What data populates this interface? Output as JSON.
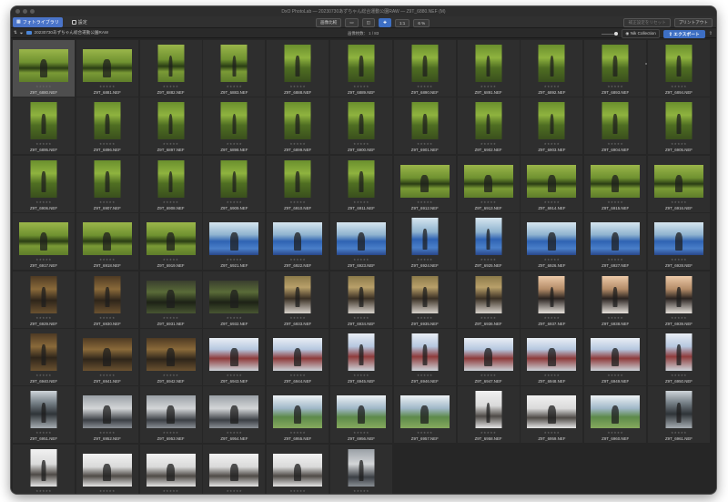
{
  "window": {
    "title": "DxO PhotoLab — 20230730あずちゃん総合運動公園RAW — Z9T_6880.NEF (M)"
  },
  "toolbar": {
    "library_tab": "フォトライブラリ",
    "settings_tab": "設定",
    "compare_button": "画像比較",
    "zoom_label": "1:1",
    "zoom_value": "6 %",
    "reset_button": "補正設定をリセット",
    "print_button": "プリントアウト"
  },
  "filterbar": {
    "folder_name": "20230730あずちゃん総合運動公園RAW",
    "image_count": "画像枚数：    1 / 83",
    "nik_button": "Nik Collection",
    "export_button": "エクスポート"
  },
  "icons": [
    "grid-icon",
    "photo-icon",
    "sort-icon",
    "filter-icon",
    "folder-icon",
    "zoom-icon",
    "nik-icon",
    "export-icon",
    "share-icon"
  ],
  "colors": {
    "accent": "#4a74c9",
    "window_bg": "#262626",
    "selected_cell": "#4e4e4e"
  },
  "rating_placeholder": "★★★★★",
  "thumbnails": [
    {
      "name": "Z9T_6880.NEF",
      "o": "l",
      "s": "s-park"
    },
    {
      "name": "Z9T_6881.NEF",
      "o": "l",
      "s": "s-park"
    },
    {
      "name": "Z9T_6882.NEF",
      "o": "p",
      "s": "s-park"
    },
    {
      "name": "Z9T_6883.NEF",
      "o": "p",
      "s": "s-park"
    },
    {
      "name": "Z9T_6888.NEF",
      "o": "p",
      "s": "s-forest"
    },
    {
      "name": "Z9T_6889.NEF",
      "o": "p",
      "s": "s-forest"
    },
    {
      "name": "Z9T_6890.NEF",
      "o": "p",
      "s": "s-forest"
    },
    {
      "name": "Z9T_6891.NEF",
      "o": "p",
      "s": "s-forest"
    },
    {
      "name": "Z9T_6892.NEF",
      "o": "p",
      "s": "s-forest"
    },
    {
      "name": "Z9T_6893.NEF",
      "o": "p",
      "s": "s-forest"
    },
    {
      "name": "Z9T_6894.NEF",
      "o": "p",
      "s": "s-forest"
    },
    {
      "name": "Z9T_6895.NEF",
      "o": "p",
      "s": "s-forest"
    },
    {
      "name": "Z9T_6896.NEF",
      "o": "p",
      "s": "s-forest"
    },
    {
      "name": "Z9T_6897.NEF",
      "o": "p",
      "s": "s-forest"
    },
    {
      "name": "Z9T_6898.NEF",
      "o": "p",
      "s": "s-forest"
    },
    {
      "name": "Z9T_6899.NEF",
      "o": "p",
      "s": "s-forest"
    },
    {
      "name": "Z9T_6900.NEF",
      "o": "p",
      "s": "s-forest"
    },
    {
      "name": "Z9T_6901.NEF",
      "o": "p",
      "s": "s-forest"
    },
    {
      "name": "Z9T_6902.NEF",
      "o": "p",
      "s": "s-forest"
    },
    {
      "name": "Z9T_6903.NEF",
      "o": "p",
      "s": "s-forest"
    },
    {
      "name": "Z9T_6904.NEF",
      "o": "p",
      "s": "s-forest"
    },
    {
      "name": "Z9T_6905.NEF",
      "o": "p",
      "s": "s-forest"
    },
    {
      "name": "Z9T_6906.NEF",
      "o": "p",
      "s": "s-forest"
    },
    {
      "name": "Z9T_6907.NEF",
      "o": "p",
      "s": "s-forest"
    },
    {
      "name": "Z9T_6908.NEF",
      "o": "p",
      "s": "s-forest"
    },
    {
      "name": "Z9T_6909.NEF",
      "o": "p",
      "s": "s-forest"
    },
    {
      "name": "Z9T_6910.NEF",
      "o": "p",
      "s": "s-forest"
    },
    {
      "name": "Z9T_6911.NEF",
      "o": "p",
      "s": "s-forest"
    },
    {
      "name": "Z9T_6912.NEF",
      "o": "l",
      "s": "s-park"
    },
    {
      "name": "Z9T_6913.NEF",
      "o": "l",
      "s": "s-park"
    },
    {
      "name": "Z9T_6914.NEF",
      "o": "l",
      "s": "s-park"
    },
    {
      "name": "Z9T_6915.NEF",
      "o": "l",
      "s": "s-park"
    },
    {
      "name": "Z9T_6916.NEF",
      "o": "l",
      "s": "s-park"
    },
    {
      "name": "Z9T_6917.NEF",
      "o": "l",
      "s": "s-park"
    },
    {
      "name": "Z9T_6918.NEF",
      "o": "l",
      "s": "s-park"
    },
    {
      "name": "Z9T_6919.NEF",
      "o": "l",
      "s": "s-park"
    },
    {
      "name": "Z9T_6921.NEF",
      "o": "l",
      "s": "s-track"
    },
    {
      "name": "Z9T_6922.NEF",
      "o": "l",
      "s": "s-track"
    },
    {
      "name": "Z9T_6923.NEF",
      "o": "l",
      "s": "s-track"
    },
    {
      "name": "Z9T_6924.NEF",
      "o": "p",
      "s": "s-track"
    },
    {
      "name": "Z9T_6925.NEF",
      "o": "p",
      "s": "s-track"
    },
    {
      "name": "Z9T_6926.NEF",
      "o": "l",
      "s": "s-track"
    },
    {
      "name": "Z9T_6927.NEF",
      "o": "l",
      "s": "s-track"
    },
    {
      "name": "Z9T_6928.NEF",
      "o": "l",
      "s": "s-track"
    },
    {
      "name": "Z9T_6929.NEF",
      "o": "p",
      "s": "s-bench"
    },
    {
      "name": "Z9T_6930.NEF",
      "o": "p",
      "s": "s-bench"
    },
    {
      "name": "Z9T_6931.NEF",
      "o": "l",
      "s": "s-dark"
    },
    {
      "name": "Z9T_6932.NEF",
      "o": "l",
      "s": "s-dark"
    },
    {
      "name": "Z9T_6933.NEF",
      "o": "p",
      "s": "s-close"
    },
    {
      "name": "Z9T_6934.NEF",
      "o": "p",
      "s": "s-close"
    },
    {
      "name": "Z9T_6935.NEF",
      "o": "p",
      "s": "s-close"
    },
    {
      "name": "Z9T_6936.NEF",
      "o": "p",
      "s": "s-close"
    },
    {
      "name": "Z9T_6937.NEF",
      "o": "p",
      "s": "s-face"
    },
    {
      "name": "Z9T_6938.NEF",
      "o": "p",
      "s": "s-face"
    },
    {
      "name": "Z9T_6939.NEF",
      "o": "p",
      "s": "s-face"
    },
    {
      "name": "Z9T_6940.NEF",
      "o": "p",
      "s": "s-bench"
    },
    {
      "name": "Z9T_6941.NEF",
      "o": "l",
      "s": "s-bench"
    },
    {
      "name": "Z9T_6942.NEF",
      "o": "l",
      "s": "s-bench"
    },
    {
      "name": "Z9T_6943.NEF",
      "o": "l",
      "s": "s-stadium"
    },
    {
      "name": "Z9T_6944.NEF",
      "o": "l",
      "s": "s-stadium"
    },
    {
      "name": "Z9T_6945.NEF",
      "o": "p",
      "s": "s-stadium"
    },
    {
      "name": "Z9T_6946.NEF",
      "o": "p",
      "s": "s-stadium"
    },
    {
      "name": "Z9T_6947.NEF",
      "o": "l",
      "s": "s-stadium"
    },
    {
      "name": "Z9T_6948.NEF",
      "o": "l",
      "s": "s-stadium"
    },
    {
      "name": "Z9T_6949.NEF",
      "o": "l",
      "s": "s-stadium"
    },
    {
      "name": "Z9T_6950.NEF",
      "o": "p",
      "s": "s-stadium"
    },
    {
      "name": "Z9T_6951.NEF",
      "o": "p",
      "s": "s-fence"
    },
    {
      "name": "Z9T_6952.NEF",
      "o": "l",
      "s": "s-bw"
    },
    {
      "name": "Z9T_6953.NEF",
      "o": "l",
      "s": "s-bw"
    },
    {
      "name": "Z9T_6954.NEF",
      "o": "l",
      "s": "s-bw"
    },
    {
      "name": "Z9T_6955.NEF",
      "o": "l",
      "s": "s-field"
    },
    {
      "name": "Z9T_6956.NEF",
      "o": "l",
      "s": "s-field"
    },
    {
      "name": "Z9T_6957.NEF",
      "o": "l",
      "s": "s-field"
    },
    {
      "name": "Z9T_6958.NEF",
      "o": "p",
      "s": "s-white"
    },
    {
      "name": "Z9T_6959.NEF",
      "o": "l",
      "s": "s-white"
    },
    {
      "name": "Z9T_6960.NEF",
      "o": "l",
      "s": "s-field"
    },
    {
      "name": "Z9T_6961.NEF",
      "o": "p",
      "s": "s-fence"
    },
    {
      "name": "Z9T_6962.NEF",
      "o": "p",
      "s": "s-white"
    },
    {
      "name": "Z9T_6963.NEF",
      "o": "l",
      "s": "s-white"
    },
    {
      "name": "Z9T_6964.NEF",
      "o": "l",
      "s": "s-white"
    },
    {
      "name": "Z9T_6965.NEF",
      "o": "l",
      "s": "s-white"
    },
    {
      "name": "Z9T_6966.NEF",
      "o": "l",
      "s": "s-white"
    },
    {
      "name": "Z9T_6967.NEF",
      "o": "p",
      "s": "s-bw"
    }
  ]
}
